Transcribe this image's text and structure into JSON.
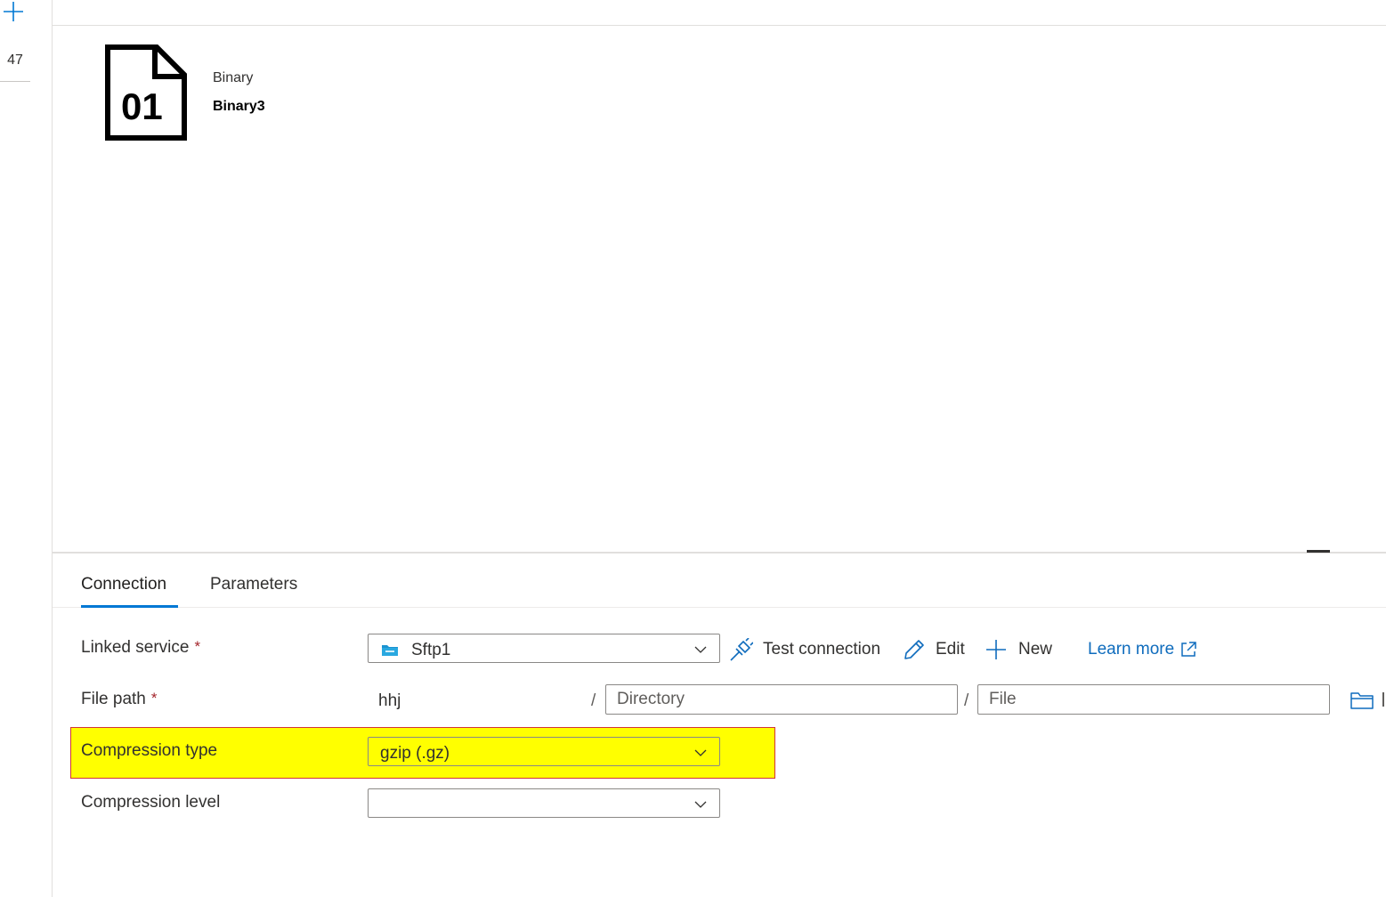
{
  "rail": {
    "count": "47"
  },
  "dataset": {
    "type": "Binary",
    "name": "Binary3",
    "icon_text": "01"
  },
  "tabs": [
    {
      "label": "Connection"
    },
    {
      "label": "Parameters"
    }
  ],
  "linked_service": {
    "label": "Linked service",
    "required_mark": "*",
    "value": "Sftp1"
  },
  "toolbar": {
    "test_connection": "Test connection",
    "edit": "Edit",
    "new": "New",
    "learn_more": "Learn more"
  },
  "file_path": {
    "label": "File path",
    "required_mark": "*",
    "container": "hhj",
    "separator": "/",
    "directory_placeholder": "Directory",
    "file_placeholder": "File"
  },
  "compression_type": {
    "label": "Compression type",
    "value": "gzip (.gz)"
  },
  "compression_level": {
    "label": "Compression level",
    "value": ""
  },
  "colors": {
    "accent": "#0078d4",
    "link": "#0f6cbd",
    "highlight": "#ffff00",
    "required": "#a4262c"
  }
}
